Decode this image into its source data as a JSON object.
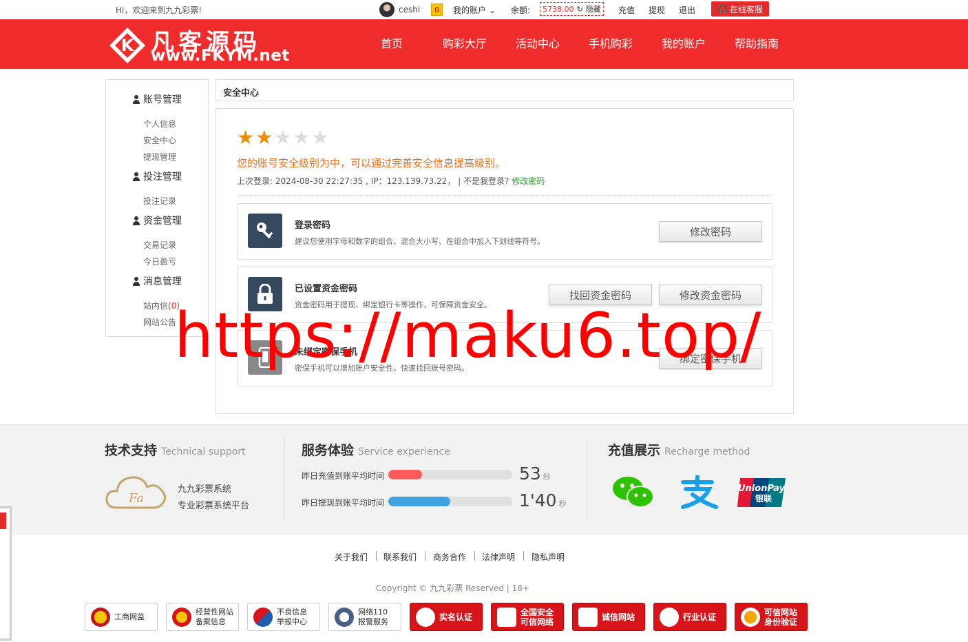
{
  "topbar": {
    "welcome": "Hi，欢迎来到九九彩票!",
    "username": "ceshi",
    "message_count": "0",
    "my_account": "我的账户",
    "balance_label": "余额:",
    "balance": "5738.00",
    "hide": "隐藏",
    "recharge": "充值",
    "withdraw": "提现",
    "logout": "退出",
    "customer_service": "在线客服"
  },
  "header": {
    "logo_cn": "凡客源码",
    "logo_en": "www.FKYM.net",
    "nav": [
      "首页",
      "购彩大厅",
      "活动中心",
      "手机购彩",
      "我的账户",
      "帮助指南"
    ]
  },
  "sidebar": {
    "groups": [
      {
        "title": "账号管理",
        "items": [
          "个人信息",
          "安全中心",
          "提现管理"
        ]
      },
      {
        "title": "投注管理",
        "items": [
          "投注记录"
        ]
      },
      {
        "title": "资金管理",
        "items": [
          "交易记录",
          "今日盈亏"
        ]
      },
      {
        "title": "消息管理",
        "items": [
          "站内信",
          "网站公告"
        ]
      }
    ],
    "inbox_count": "(0)"
  },
  "main": {
    "title": "安全中心",
    "stars_filled": 2,
    "stars_total": 5,
    "level_text": "您的账号安全级别为中，可以通过完善安全信息提高级别。",
    "last_login": "上次登录:   2024-08-30 22:27:35 , IP：123.139.73.22，   | 不是我登录?",
    "change_password_link": "修改密码",
    "cards": [
      {
        "title": "登录密码",
        "desc": "建议您使用字母和数字的组合、混合大小写、在组合中加入下划线等符号。",
        "buttons": [
          "修改密码"
        ]
      },
      {
        "title": "已设置资金密码",
        "desc": "资金密码用于提现、绑定银行卡等操作，可保障资金安全。",
        "buttons": [
          "找回资金密码",
          "修改资金密码"
        ]
      },
      {
        "title": "未绑定密保手机",
        "desc": "密保手机可以增加账户安全性，快速找回账号密码。",
        "buttons": [
          "绑定密保手机"
        ]
      }
    ]
  },
  "watermark": "https://maku6.top/",
  "footer_band": {
    "tech": {
      "title": "技术支持",
      "sub": "Technical support",
      "line1": "九九彩票系统",
      "line2": "专业彩票系统平台"
    },
    "service": {
      "title": "服务体验",
      "sub": "Service experience",
      "rows": [
        {
          "label": "昨日充值到账平均时间",
          "value": "53",
          "unit": "秒",
          "fill": 0.27,
          "color": "#ff5b5b"
        },
        {
          "label": "昨日提现到账平均时间",
          "value": "1'40",
          "unit": "秒",
          "fill": 0.5,
          "color": "#3fa3df"
        }
      ]
    },
    "recharge": {
      "title": "充值展示",
      "sub": "Recharge method"
    }
  },
  "footer": {
    "links": [
      "关于我们",
      "联系我们",
      "商务合作",
      "法律声明",
      "隐私声明"
    ],
    "copyright": "Copyright © 九九彩票 Reserved | 18+",
    "certs": [
      "工商网监",
      "经营性网站\n备案信息",
      "不良信息\n举报中心",
      "网络110\n报警服务",
      "实名认证",
      "全国安全\n可信网络",
      "诚信网站",
      "行业认证",
      "可信网站\n身份验证"
    ]
  }
}
